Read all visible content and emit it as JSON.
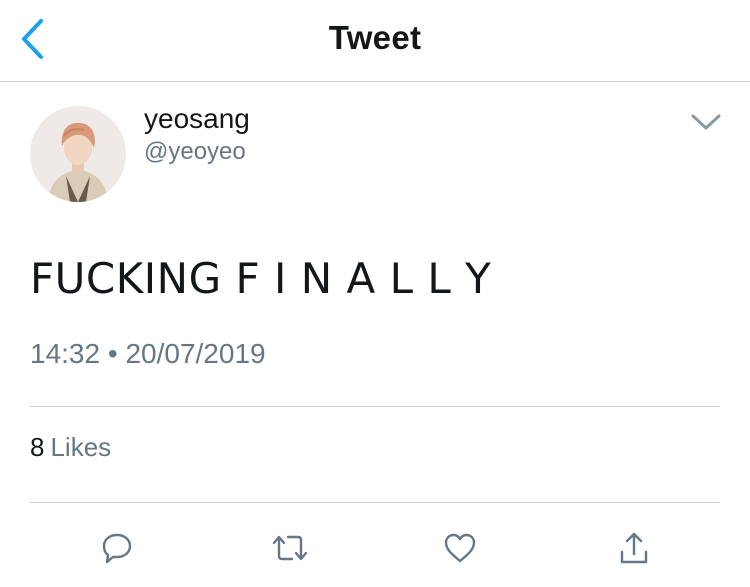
{
  "header": {
    "title": "Tweet",
    "back_icon": "chevron-left-icon",
    "accent_color": "#1da1f2"
  },
  "tweet": {
    "author": {
      "display_name": "yeosang",
      "handle": "@yeoyeo"
    },
    "text": "FUCKING F I N A L L Y",
    "time": "14:32",
    "separator": "•",
    "date": "20/07/2019",
    "likes": {
      "count": "8",
      "label": "Likes"
    }
  },
  "actions": [
    "reply-icon",
    "retweet-icon",
    "like-icon",
    "share-icon"
  ],
  "colors": {
    "text_primary": "#14171a",
    "text_secondary": "#657786",
    "divider": "#cfd3d6",
    "icon_gray": "#657786"
  }
}
